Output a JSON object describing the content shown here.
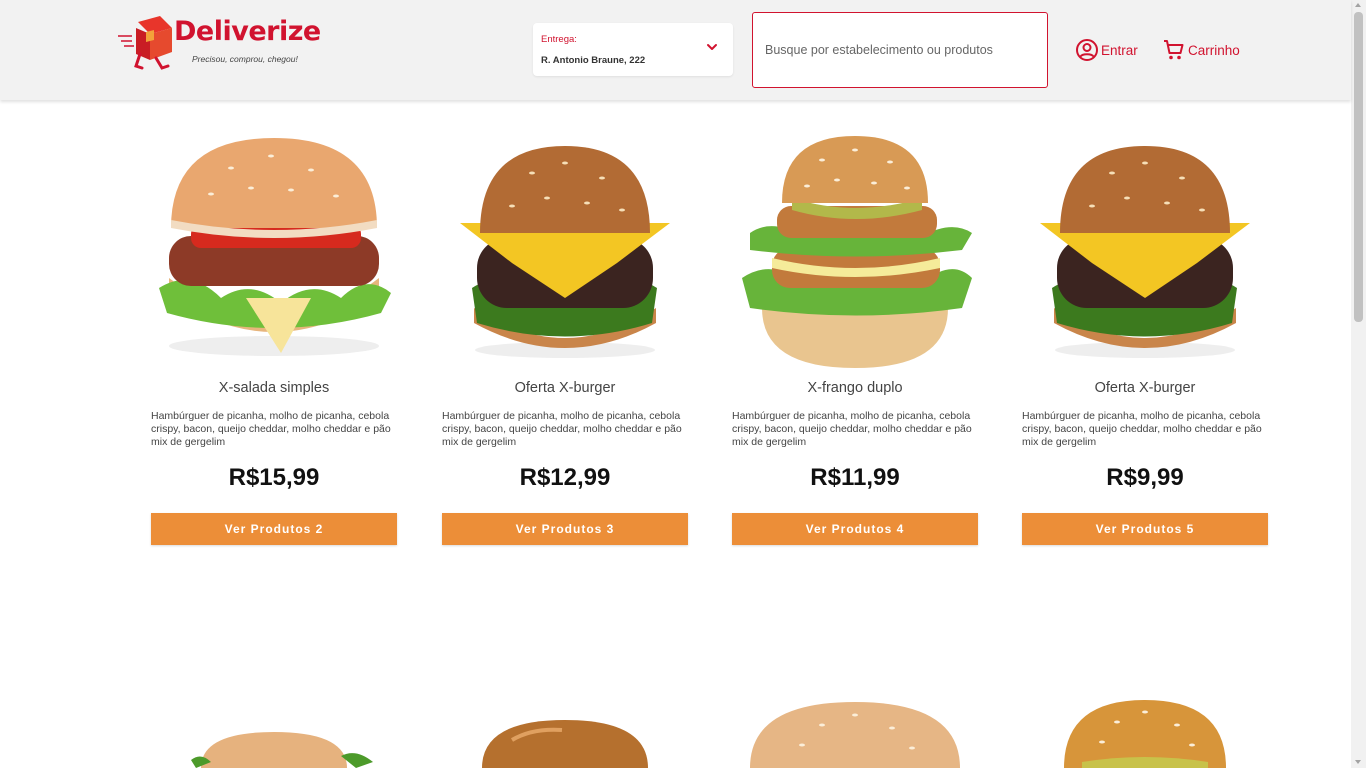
{
  "brand": {
    "name": "Deliverize",
    "tagline": "Precisou, comprou, chegou!",
    "color": "#d1132f"
  },
  "delivery": {
    "label": "Entrega:",
    "address": "R. Antonio Braune, 222"
  },
  "search": {
    "placeholder": "Busque por estabelecimento ou produtos"
  },
  "nav": {
    "login": "Entrar",
    "cart": "Carrinho"
  },
  "products": [
    {
      "name": "X-salada simples",
      "description": "Hambúrguer de picanha, molho de picanha, cebola crispy, bacon, queijo cheddar, molho cheddar e pão mix de gergelim",
      "price": "R$15,99",
      "button": "Ver Produtos 2"
    },
    {
      "name": "Oferta X-burger",
      "description": "Hambúrguer de picanha, molho de picanha, cebola crispy, bacon, queijo cheddar, molho cheddar e pão mix de gergelim",
      "price": "R$12,99",
      "button": "Ver Produtos 3"
    },
    {
      "name": "X-frango duplo",
      "description": "Hambúrguer de picanha, molho de picanha, cebola crispy, bacon, queijo cheddar, molho cheddar e pão mix de gergelim",
      "price": "R$11,99",
      "button": "Ver Produtos 4"
    },
    {
      "name": "Oferta X-burger",
      "description": "Hambúrguer de picanha, molho de picanha, cebola crispy, bacon, queijo cheddar, molho cheddar e pão mix de gergelim",
      "price": "R$9,99",
      "button": "Ver Produtos 5"
    }
  ],
  "colors": {
    "accent": "#d1132f",
    "button": "#ec8e38",
    "header_bg": "#f2f2f2"
  }
}
